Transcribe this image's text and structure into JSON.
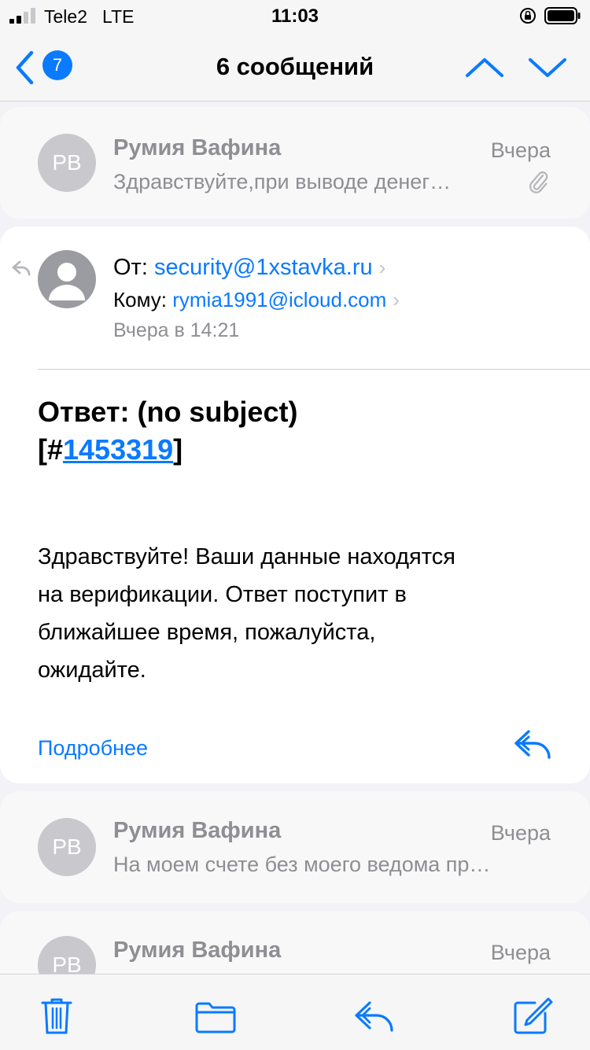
{
  "status_bar": {
    "carrier": "Tele2",
    "network": "LTE",
    "time": "11:03",
    "icons": [
      "signal-icon",
      "orientation-lock-icon",
      "battery-icon"
    ]
  },
  "nav": {
    "unread_count": "7",
    "title": "6 сообщений",
    "icons": [
      "chevron-left-icon",
      "chevron-up-icon",
      "chevron-down-icon"
    ]
  },
  "messages": [
    {
      "avatar_initials": "РВ",
      "sender": "Румия Вафина",
      "date": "Вчера",
      "preview": "Здравствуйте,при выводе денег…",
      "has_attachment": true
    },
    {
      "avatar_initials": "РВ",
      "sender": "Румия Вафина",
      "date": "Вчера",
      "preview": "На моем счете без моего ведома пр…"
    },
    {
      "avatar_initials": "РВ",
      "sender": "Румия Вафина",
      "date": "Вчера"
    }
  ],
  "open_message": {
    "from_label": "От:",
    "from_address": "security@1xstavka.ru",
    "to_label": "Кому:",
    "to_address": "rymia1991@icloud.com",
    "sent_time": "Вчера в 14:21",
    "subject_prefix": "Ответ:  (no subject)",
    "subject_bracket_open": "[#",
    "ticket_number": "1453319",
    "subject_bracket_close": "]",
    "body_lines": [
      "Здравствуйте! Ваши данные находятся",
      "на верификации. Ответ поступит в",
      "ближайшее время, пожалуйста,",
      "ожидайте."
    ],
    "more_label": "Подробнее"
  },
  "toolbar": {
    "icons": [
      "trash-icon",
      "folder-icon",
      "reply-icon",
      "compose-icon"
    ]
  },
  "colors": {
    "accent": "#0a7aff",
    "secondary_text": "#8e8e93",
    "background": "#f2f2f7"
  }
}
